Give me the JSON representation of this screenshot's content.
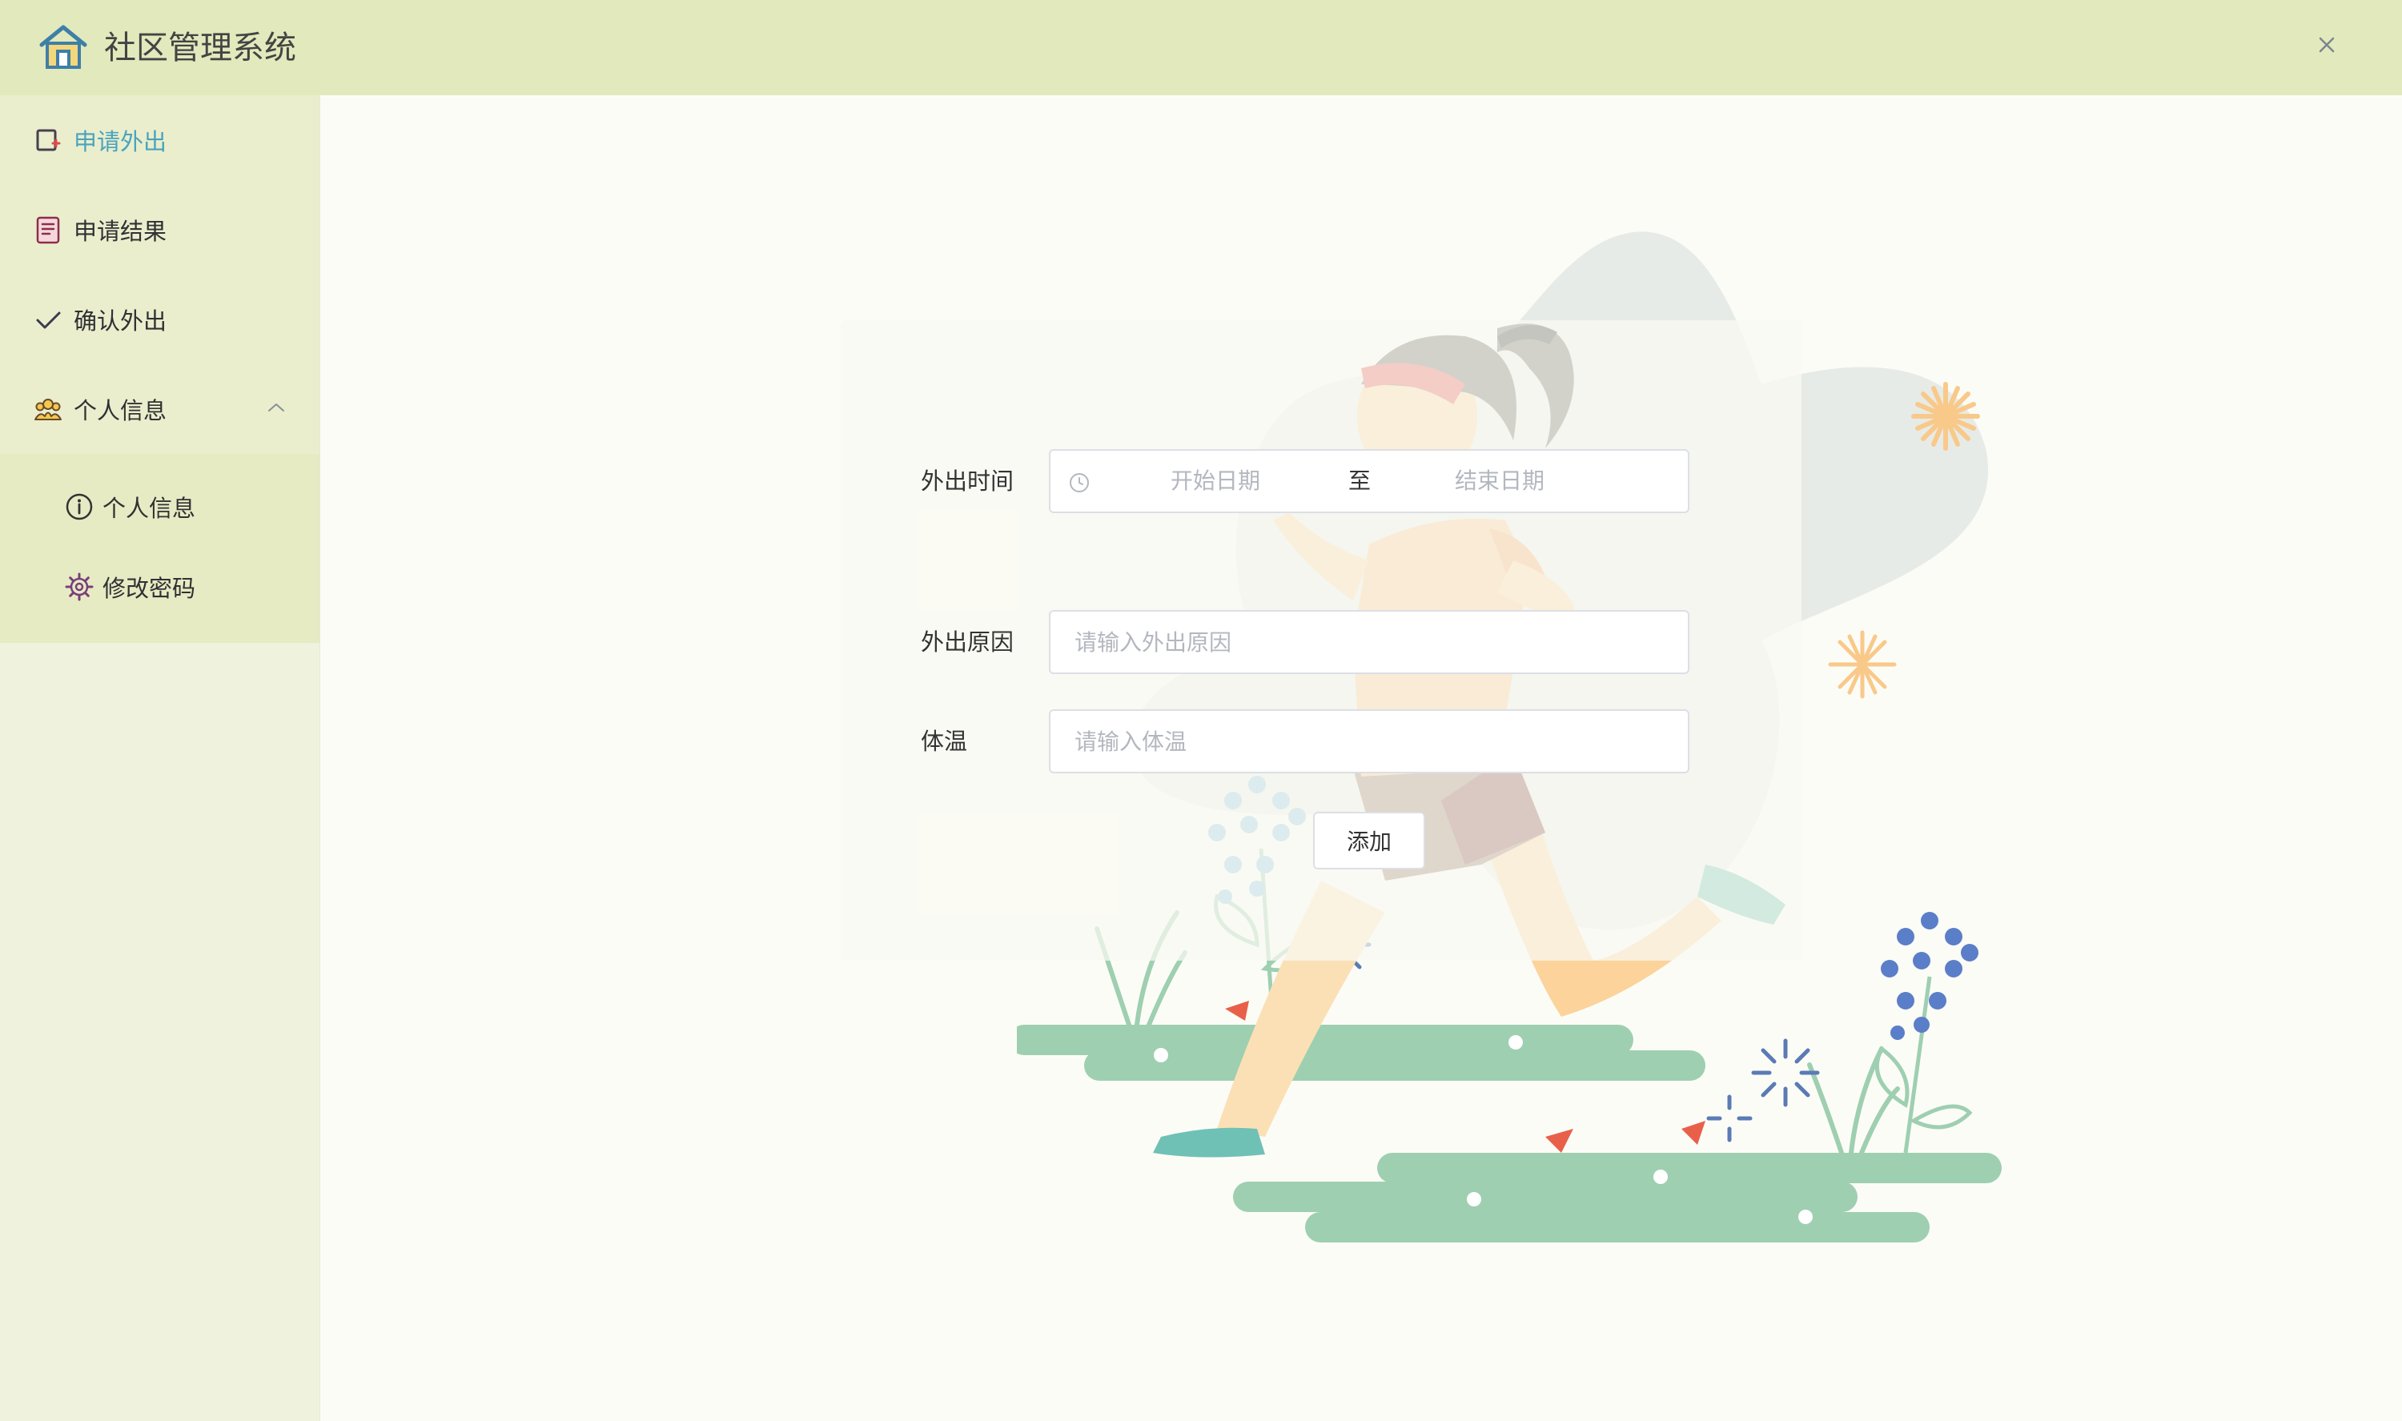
{
  "header": {
    "title": "社区管理系统",
    "logo_icon": "home-icon",
    "close_icon": "close-icon"
  },
  "sidebar": {
    "items": [
      {
        "label": "申请外出",
        "icon": "apply-form-icon",
        "active": true
      },
      {
        "label": "申请结果",
        "icon": "document-list-icon",
        "active": false
      },
      {
        "label": "确认外出",
        "icon": "check-icon",
        "active": false
      },
      {
        "label": "个人信息",
        "icon": "users-icon",
        "expanded": true
      }
    ],
    "submenu": [
      {
        "label": "个人信息",
        "icon": "info-icon"
      },
      {
        "label": "修改密码",
        "icon": "gear-icon"
      }
    ]
  },
  "form": {
    "time_label": "外出时间",
    "start_placeholder": "开始日期",
    "range_separator": "至",
    "end_placeholder": "结束日期",
    "reason_label": "外出原因",
    "reason_placeholder": "请输入外出原因",
    "temp_label": "体温",
    "temp_placeholder": "请输入体温",
    "submit_label": "添加"
  },
  "colors": {
    "header_bg": "#e2e9bc",
    "sidebar_bg": "#eff2dd",
    "active_text": "#4aa3bd",
    "page_bg": "#fcfcf7"
  }
}
